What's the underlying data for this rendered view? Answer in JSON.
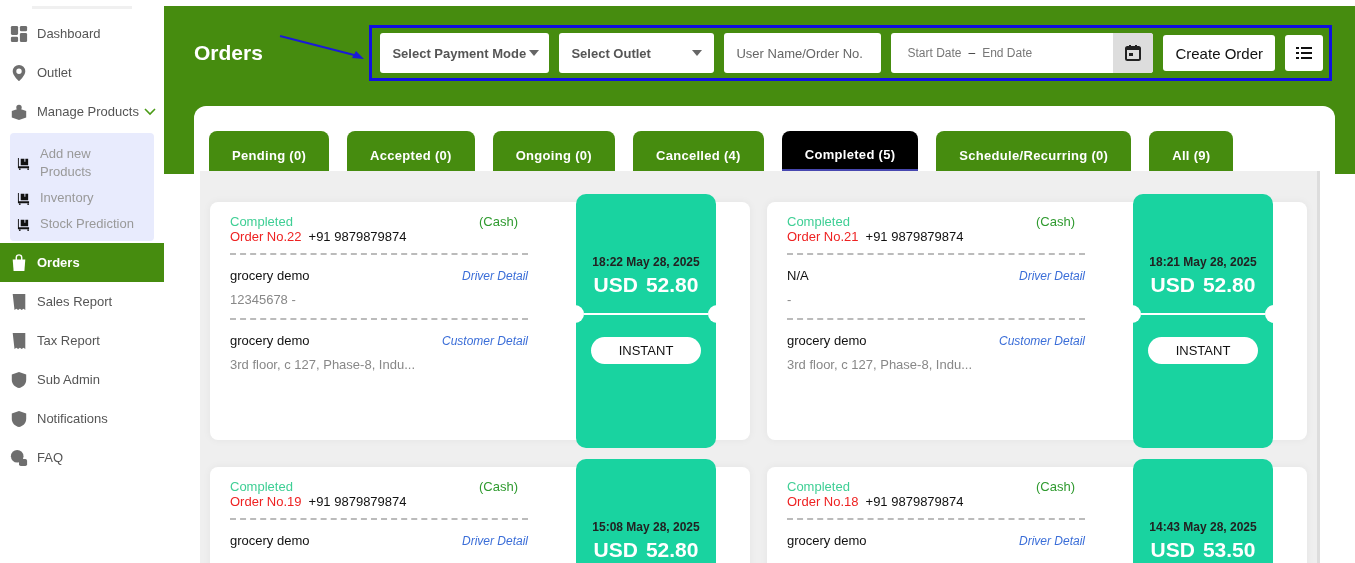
{
  "sidebar": {
    "items": [
      {
        "label": "Dashboard",
        "selected": false
      },
      {
        "label": "Outlet",
        "selected": false
      },
      {
        "label": "Manage Products",
        "selected": false,
        "expanded": true,
        "children": [
          {
            "label": "Add new Products"
          },
          {
            "label": "Inventory"
          },
          {
            "label": "Stock Prediction"
          }
        ]
      },
      {
        "label": "Orders",
        "selected": true
      },
      {
        "label": "Sales Report",
        "selected": false
      },
      {
        "label": "Tax Report",
        "selected": false
      },
      {
        "label": "Sub Admin",
        "selected": false
      },
      {
        "label": "Notifications",
        "selected": false
      },
      {
        "label": "FAQ",
        "selected": false
      }
    ]
  },
  "header": {
    "title": "Orders",
    "payment_mode": {
      "placeholder": "Select Payment Mode"
    },
    "outlet": {
      "placeholder": "Select Outlet"
    },
    "search": {
      "placeholder": "User Name/Order No."
    },
    "start_date": {
      "placeholder": "Start Date"
    },
    "date_separator": "–",
    "end_date": {
      "placeholder": "End Date"
    },
    "create_button": "Create Order"
  },
  "tabs": [
    {
      "label": "Pending (0)",
      "selected": false
    },
    {
      "label": "Accepted (0)",
      "selected": false
    },
    {
      "label": "Ongoing (0)",
      "selected": false
    },
    {
      "label": "Cancelled (4)",
      "selected": false
    },
    {
      "label": "Completed (5)",
      "selected": true
    },
    {
      "label": "Schedule/Recurring (0)",
      "selected": false
    },
    {
      "label": "All (9)",
      "selected": false
    }
  ],
  "orders": [
    {
      "status": "Completed",
      "payment": "(Cash)",
      "order_no": "Order No.22",
      "phone": "+91 9879879874",
      "driver_name": "grocery demo",
      "driver_phone": "12345678 -",
      "driver_link": "Driver Detail",
      "customer_name": "grocery demo",
      "customer_link": "Customer Detail",
      "address": "3rd floor, c 127, Phase-8, Indu...",
      "datetime": "18:22 May 28, 2025",
      "currency": "USD",
      "amount": "52.80",
      "type": "INSTANT"
    },
    {
      "status": "Completed",
      "payment": "(Cash)",
      "order_no": "Order No.21",
      "phone": "+91 9879879874",
      "driver_name": "N/A",
      "driver_phone": "-",
      "driver_link": "Driver Detail",
      "customer_name": "grocery demo",
      "customer_link": "Customer Detail",
      "address": "3rd floor, c 127, Phase-8, Indu...",
      "datetime": "18:21 May 28, 2025",
      "currency": "USD",
      "amount": "52.80",
      "type": "INSTANT"
    },
    {
      "status": "Completed",
      "payment": "(Cash)",
      "order_no": "Order No.19",
      "phone": "+91 9879879874",
      "driver_name": "grocery demo",
      "driver_link": "Driver Detail",
      "datetime": "15:08 May 28, 2025",
      "currency": "USD",
      "amount": "52.80"
    },
    {
      "status": "Completed",
      "payment": "(Cash)",
      "order_no": "Order No.18",
      "phone": "+91 9879879874",
      "driver_name": "grocery demo",
      "driver_link": "Driver Detail",
      "datetime": "14:43 May 28, 2025",
      "currency": "USD",
      "amount": "53.50"
    }
  ]
}
